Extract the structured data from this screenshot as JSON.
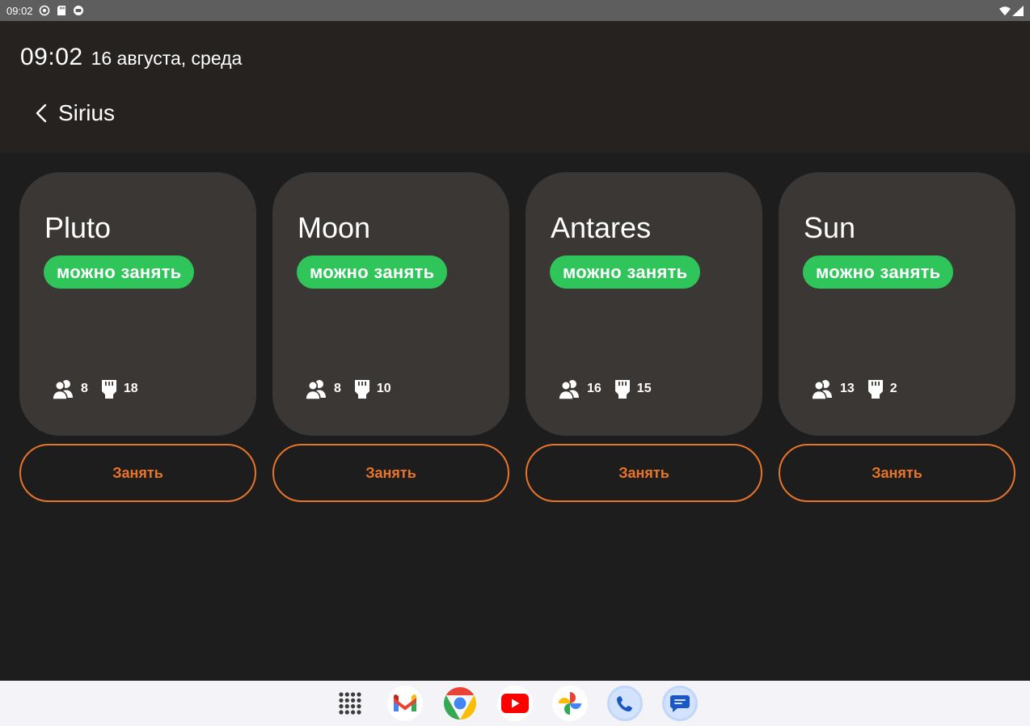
{
  "statusbar": {
    "time": "09:02"
  },
  "header": {
    "time": "09:02",
    "date": "16 августа, среда",
    "location": "Sirius"
  },
  "rooms": [
    {
      "name": "Pluto",
      "status": "можно занять",
      "people": "8",
      "ports": "18",
      "action": "Занять"
    },
    {
      "name": "Moon",
      "status": "можно занять",
      "people": "8",
      "ports": "10",
      "action": "Занять"
    },
    {
      "name": "Antares",
      "status": "можно занять",
      "people": "16",
      "ports": "15",
      "action": "Занять"
    },
    {
      "name": "Sun",
      "status": "можно занять",
      "people": "13",
      "ports": "2",
      "action": "Занять"
    }
  ],
  "colors": {
    "background": "#1e1d1d",
    "header": "#262220",
    "card": "#3b3734",
    "available": "#2fc55a",
    "accent": "#e8742a"
  },
  "dock": {
    "apps": [
      "app-drawer-icon",
      "gmail-icon",
      "chrome-icon",
      "youtube-icon",
      "photos-icon",
      "phone-icon",
      "messages-icon"
    ]
  }
}
